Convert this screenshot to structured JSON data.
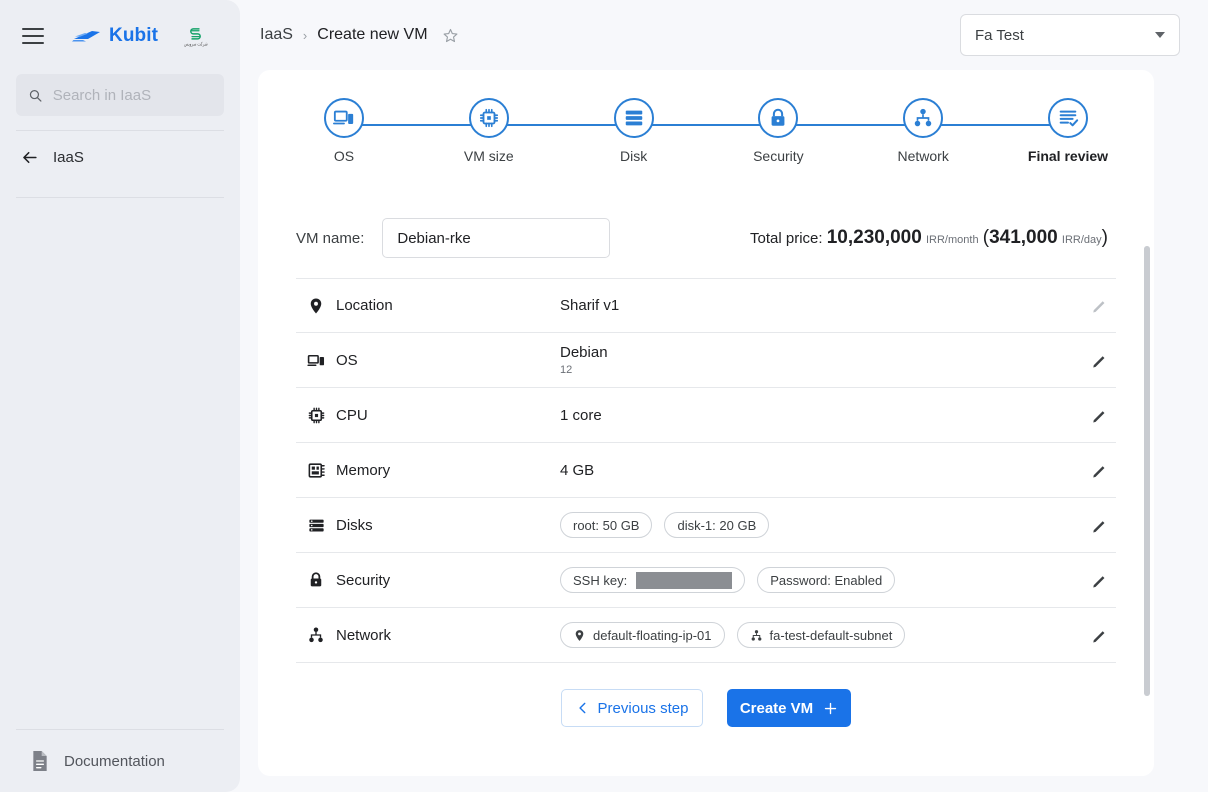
{
  "sidebar": {
    "menu_icon": "hamburger-icon",
    "brand": "Kubit",
    "partner_logo_caption": "شرکت سرویس",
    "search": {
      "placeholder": "Search in IaaS",
      "value": "",
      "icon": "search-icon"
    },
    "items": [
      {
        "label": "IaaS",
        "icon": "arrow-left-icon"
      }
    ],
    "footer": {
      "label": "Documentation",
      "icon": "document-icon"
    }
  },
  "topbar": {
    "breadcrumb": [
      "IaaS",
      "Create new VM"
    ],
    "breadcrumb_separator": "›",
    "favorite_icon": "star-icon",
    "account_select": {
      "value": "Fa Test",
      "icon": "chevron-down-icon"
    }
  },
  "stepper": {
    "steps": [
      {
        "label": "OS",
        "icon": "devices-icon",
        "active": false
      },
      {
        "label": "VM size",
        "icon": "cpu-chip-icon",
        "active": false
      },
      {
        "label": "Disk",
        "icon": "storage-icon",
        "active": false
      },
      {
        "label": "Security",
        "icon": "lock-icon",
        "active": false
      },
      {
        "label": "Network",
        "icon": "sitemap-icon",
        "active": false
      },
      {
        "label": "Final review",
        "icon": "checklist-icon",
        "active": true
      }
    ]
  },
  "form": {
    "name_label": "VM name:",
    "name_value": "Debian-rke",
    "name_placeholder": "",
    "price": {
      "prefix": "Total price:",
      "monthly_amount": "10,230,000",
      "monthly_unit": "IRR/month",
      "open_paren": "(",
      "daily_amount": "341,000",
      "daily_unit": "IRR/day",
      "close_paren": ")"
    }
  },
  "summary_rows": [
    {
      "label": "Location",
      "icon": "location-pin-icon",
      "value": "Sharif v1",
      "sub": "",
      "edit_icon": "pencil-icon"
    },
    {
      "label": "OS",
      "icon": "devices-icon",
      "value": "Debian",
      "sub": "12",
      "edit_icon": "pencil-icon"
    },
    {
      "label": "CPU",
      "icon": "cpu-chip-icon",
      "value": "1 core",
      "sub": "",
      "edit_icon": "pencil-icon"
    },
    {
      "label": "Memory",
      "icon": "memory-icon",
      "value": "4 GB",
      "sub": "",
      "edit_icon": "pencil-icon"
    },
    {
      "label": "Disks",
      "icon": "storage-icon",
      "chips": [
        {
          "text": "root: 50 GB",
          "icon": ""
        },
        {
          "text": "disk-1: 20 GB",
          "icon": ""
        }
      ],
      "edit_icon": "pencil-icon"
    },
    {
      "label": "Security",
      "icon": "lock-icon",
      "chips": [
        {
          "text": "SSH key:",
          "icon": "",
          "redacted": true
        },
        {
          "text": "Password: Enabled",
          "icon": ""
        }
      ],
      "edit_icon": "pencil-icon"
    },
    {
      "label": "Network",
      "icon": "sitemap-icon",
      "chips": [
        {
          "text": "default-floating-ip-01",
          "icon": "location-pin-icon"
        },
        {
          "text": "fa-test-default-subnet",
          "icon": "sitemap-icon"
        }
      ],
      "edit_icon": "pencil-icon"
    }
  ],
  "actions": {
    "previous_label": "Previous step",
    "previous_icon": "chevron-left-icon",
    "create_label": "Create VM",
    "create_icon": "plus-icon"
  },
  "colors": {
    "accent": "#1a73e8",
    "stepper": "#2b7fd4",
    "page_bg": "#f7f8fb",
    "sidebar_bg": "#eceef3",
    "card_bg": "#ffffff",
    "redaction": "#8b8e93"
  }
}
